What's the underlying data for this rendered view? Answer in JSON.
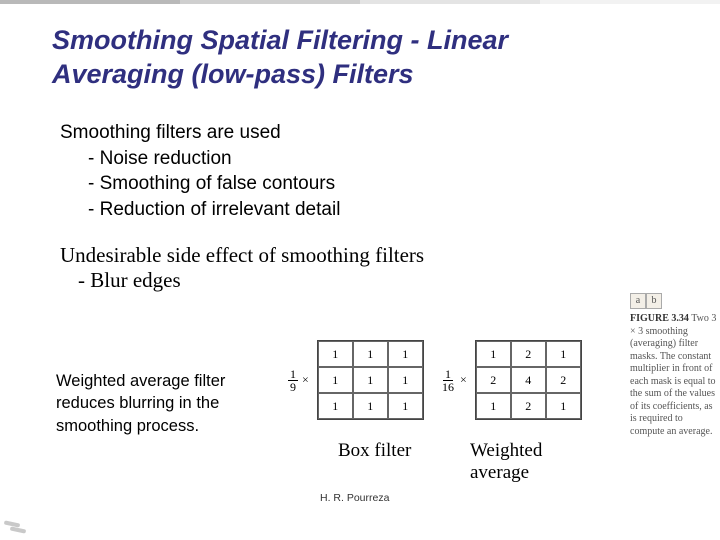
{
  "title_line1": "Smoothing Spatial Filtering - Linear",
  "title_line2": "Averaging (low-pass) Filters",
  "block1": {
    "lead": "Smoothing filters are used",
    "items": [
      "Noise reduction",
      "Smoothing of false contours",
      "Reduction of irrelevant detail"
    ]
  },
  "block2": {
    "lead": "Undesirable side effect of smoothing filters",
    "items": [
      "Blur edges"
    ]
  },
  "weighted_note": "Weighted average filter reduces blurring in the smoothing process.",
  "chart_data": [
    {
      "type": "table",
      "name": "box_filter",
      "scalar_num": "1",
      "scalar_den": "9",
      "matrix": [
        [
          1,
          1,
          1
        ],
        [
          1,
          1,
          1
        ],
        [
          1,
          1,
          1
        ]
      ],
      "caption": "Box filter"
    },
    {
      "type": "table",
      "name": "weighted_average_filter",
      "scalar_num": "1",
      "scalar_den": "16",
      "matrix": [
        [
          1,
          2,
          1
        ],
        [
          2,
          4,
          2
        ],
        [
          1,
          2,
          1
        ]
      ],
      "caption": "Weighted average"
    }
  ],
  "figure_sidebar": {
    "labels": [
      "a",
      "b"
    ],
    "fignum": "FIGURE 3.34",
    "text": "Two 3 × 3 smoothing (averaging) filter masks. The constant multiplier in front of each mask is equal to the sum of the values of its coefficients, as is required to compute an average."
  },
  "footer": "H. R. Pourreza"
}
